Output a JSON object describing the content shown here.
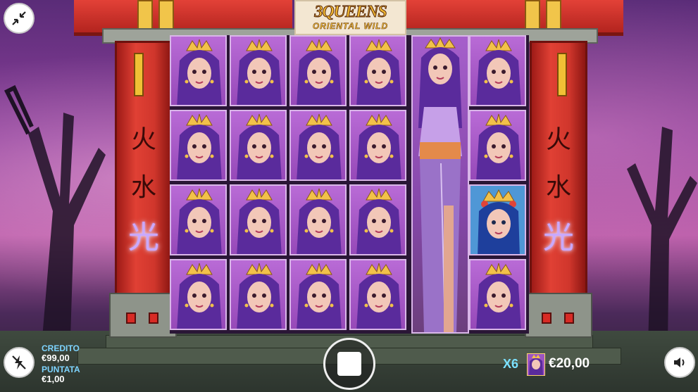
{
  "game": {
    "logo_title": "3QUEENS",
    "logo_subtitle": "ORIENTAL WILD"
  },
  "pillars": {
    "left_glyphs": [
      "火",
      "水",
      "光"
    ],
    "right_glyphs": [
      "火",
      "水",
      "光"
    ]
  },
  "reels": {
    "columns": 6,
    "rows": 4,
    "symbols": [
      [
        "purple-queen",
        "purple-queen",
        "purple-queen",
        "purple-queen",
        "tall-queen",
        "purple-queen"
      ],
      [
        "purple-queen",
        "purple-queen",
        "purple-queen",
        "purple-queen",
        "tall-queen",
        "purple-queen"
      ],
      [
        "purple-queen",
        "purple-queen",
        "purple-queen",
        "purple-queen",
        "tall-queen",
        "blue-queen"
      ],
      [
        "purple-queen",
        "purple-queen",
        "purple-queen",
        "purple-queen",
        "tall-queen",
        "purple-queen"
      ]
    ]
  },
  "hud": {
    "credit_label": "CREDITO",
    "credit_value": "€99,00",
    "bet_label": "PUNTATA",
    "bet_value": "€1,00",
    "win_multiplier": "X6",
    "win_amount": "€20,00"
  },
  "icons": {
    "fullscreen": "collapse-arrows-icon",
    "turbo": "lightning-off-icon",
    "stop": "stop-icon",
    "sound": "speaker-icon"
  },
  "colors": {
    "pillar_red": "#d0362c",
    "gold": "#f1c54a",
    "symbol_purple": "#9649b8",
    "hud_label": "#7ed4ff"
  }
}
